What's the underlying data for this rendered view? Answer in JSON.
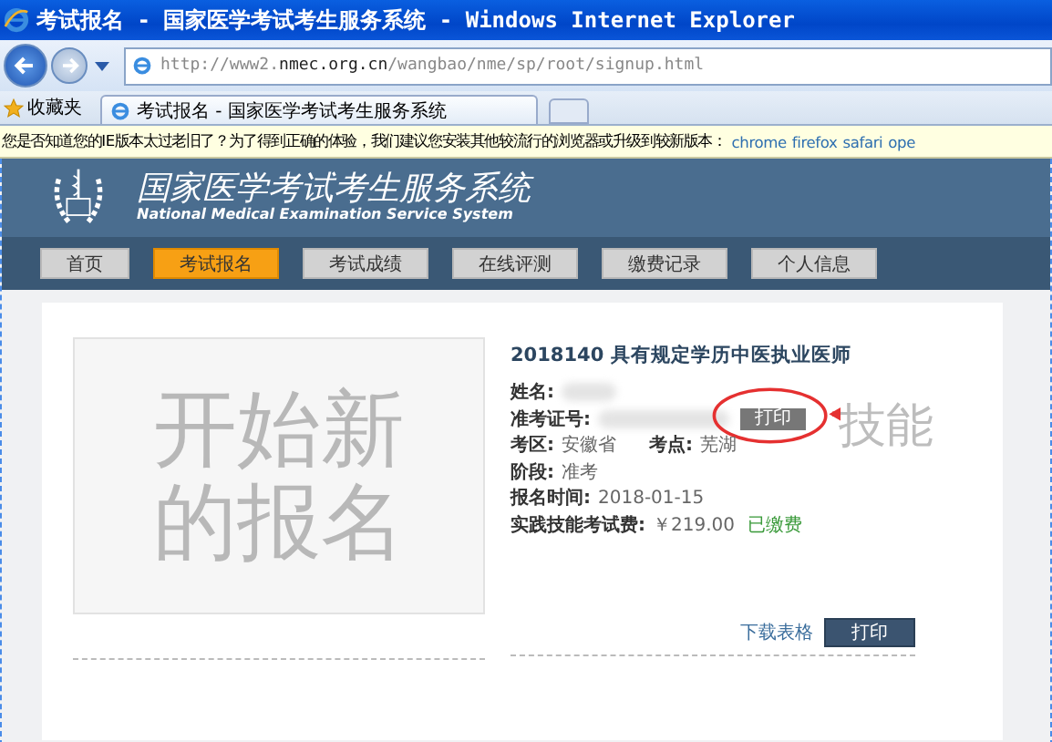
{
  "window": {
    "title": "考试报名 - 国家医学考试考生服务系统 - Windows Internet Explorer"
  },
  "address_bar": {
    "url_prefix": "http://www2.",
    "url_domain": "nmec.org.cn",
    "url_path": "/wangbao/nme/sp/root/signup.html"
  },
  "favorites": {
    "label": "收藏夹"
  },
  "tabs": [
    {
      "label": "考试报名 - 国家医学考试考生服务系统",
      "selected": true
    }
  ],
  "info_bar": {
    "text": "您是否知道您的IE版本太过老旧了？为了得到正确的体验，我们建议您安装其他较流行的浏览器或升级到较新版本：",
    "links": [
      "chrome",
      "firefox",
      "safari",
      "ope"
    ]
  },
  "site": {
    "title": "国家医学考试考生服务系统",
    "subtitle": "National Medical Examination Service System"
  },
  "nav": [
    {
      "label": "首页",
      "selected": false
    },
    {
      "label": "考试报名",
      "selected": true
    },
    {
      "label": "考试成绩",
      "selected": false
    },
    {
      "label": "在线评测",
      "selected": false
    },
    {
      "label": "缴费记录",
      "selected": false
    },
    {
      "label": "个人信息",
      "selected": false
    }
  ],
  "new_signup": {
    "label_line1": "开始新",
    "label_line2": "的报名"
  },
  "registration": {
    "title": "2018140 具有规定学历中医执业医师",
    "watermark": "技能",
    "name_label": "姓名:",
    "ticket_label": "准考证号:",
    "ticket_button": "打印",
    "area_label": "考区:",
    "area": "安徽省",
    "site_label": "考点:",
    "site": "芜湖",
    "stage_label": "阶段:",
    "stage": "准考",
    "date_label": "报名时间:",
    "date": "2018-01-15",
    "fee_label": "实践技能考试费:",
    "fee": "￥219.00",
    "paid_status": "已缴费",
    "download_link": "下载表格",
    "print_button": "打印"
  }
}
